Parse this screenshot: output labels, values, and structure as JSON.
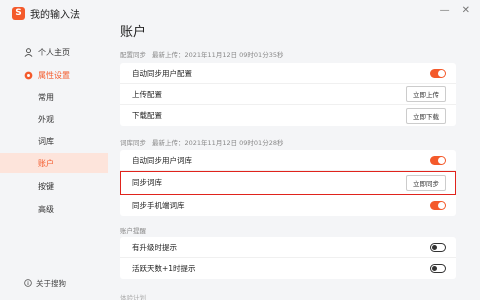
{
  "app": {
    "name": "我的输入法",
    "logo_letter": "S"
  },
  "sidebar": {
    "items": [
      {
        "label": "个人主页"
      },
      {
        "label": "属性设置"
      }
    ],
    "subitems": [
      {
        "label": "常用"
      },
      {
        "label": "外观"
      },
      {
        "label": "词库"
      },
      {
        "label": "账户"
      },
      {
        "label": "按键"
      },
      {
        "label": "高级"
      }
    ],
    "bottom": {
      "label": "关于搜狗"
    }
  },
  "main": {
    "title": "账户",
    "sections": [
      {
        "head": "配置同步",
        "sync": "最新上传：2021年11月12日 09时01分35秒",
        "rows": [
          {
            "label": "自动同步用户配置",
            "control": "toggle",
            "state": "on"
          },
          {
            "label": "上传配置",
            "control": "button",
            "button": "立即上传"
          },
          {
            "label": "下载配置",
            "control": "button",
            "button": "立即下载"
          }
        ]
      },
      {
        "head": "词库同步",
        "sync": "最新上传：2021年11月12日 09时01分28秒",
        "rows": [
          {
            "label": "自动同步用户词库",
            "control": "toggle",
            "state": "on"
          },
          {
            "label": "同步词库",
            "control": "button",
            "button": "立即同步"
          },
          {
            "label": "同步手机端词库",
            "control": "toggle",
            "state": "on"
          }
        ]
      },
      {
        "head": "账户提醒",
        "rows": [
          {
            "label": "有升级时提示",
            "control": "toggle",
            "state": "off"
          },
          {
            "label": "活跃天数+1时提示",
            "control": "toggle",
            "state": "off"
          }
        ]
      },
      {
        "head": "体验计划"
      }
    ]
  },
  "window": {
    "minimize": "—",
    "close": "✕"
  },
  "colors": {
    "accent": "#f45a2b",
    "highlight": "#e0231c"
  }
}
